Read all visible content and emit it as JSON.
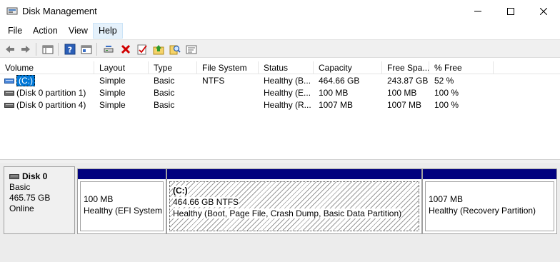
{
  "window": {
    "title": "Disk Management",
    "app_icon": "disk-management-icon",
    "controls": [
      "minimize-icon",
      "maximize-icon",
      "close-icon"
    ]
  },
  "menu": {
    "items": [
      {
        "label": "File"
      },
      {
        "label": "Action"
      },
      {
        "label": "View"
      },
      {
        "label": "Help"
      }
    ],
    "active": "Help"
  },
  "toolbar": {
    "buttons": [
      "back-arrow-icon",
      "forward-arrow-icon",
      "console-tree-icon",
      "help-icon",
      "properties-view-icon",
      "connect-drive-icon",
      "delete-icon",
      "checklist-icon",
      "up-folder-icon",
      "search-icon",
      "settings-list-icon"
    ]
  },
  "volumes": {
    "columns": [
      "Volume",
      "Layout",
      "Type",
      "File System",
      "Status",
      "Capacity",
      "Free Spa...",
      "% Free"
    ],
    "rows": [
      {
        "volume": "(C:)",
        "layout": "Simple",
        "type": "Basic",
        "fs": "NTFS",
        "status": "Healthy (B...",
        "capacity": "464.66 GB",
        "free": "243.87 GB",
        "pct": "52 %"
      },
      {
        "volume": "(Disk 0 partition 1)",
        "layout": "Simple",
        "type": "Basic",
        "fs": "",
        "status": "Healthy (E...",
        "capacity": "100 MB",
        "free": "100 MB",
        "pct": "100 %"
      },
      {
        "volume": "(Disk 0 partition 4)",
        "layout": "Simple",
        "type": "Basic",
        "fs": "",
        "status": "Healthy (R...",
        "capacity": "1007 MB",
        "free": "1007 MB",
        "pct": "100 %"
      }
    ],
    "selected_row": 0
  },
  "disk": {
    "name": "Disk 0",
    "type": "Basic",
    "size": "465.75 GB",
    "state": "Online",
    "partitions": [
      {
        "label": "",
        "size": "100 MB",
        "status": "Healthy (EFI System P"
      },
      {
        "label": "(C:)",
        "size": "464.66 GB NTFS",
        "status": "Healthy (Boot, Page File, Crash Dump, Basic Data Partition)"
      },
      {
        "label": "",
        "size": "1007 MB",
        "status": "Healthy (Recovery Partition)"
      }
    ]
  },
  "colors": {
    "partition_bar": "#00007f",
    "selection": "#0078d7",
    "toolbar_bg": "#f0f0f0"
  }
}
